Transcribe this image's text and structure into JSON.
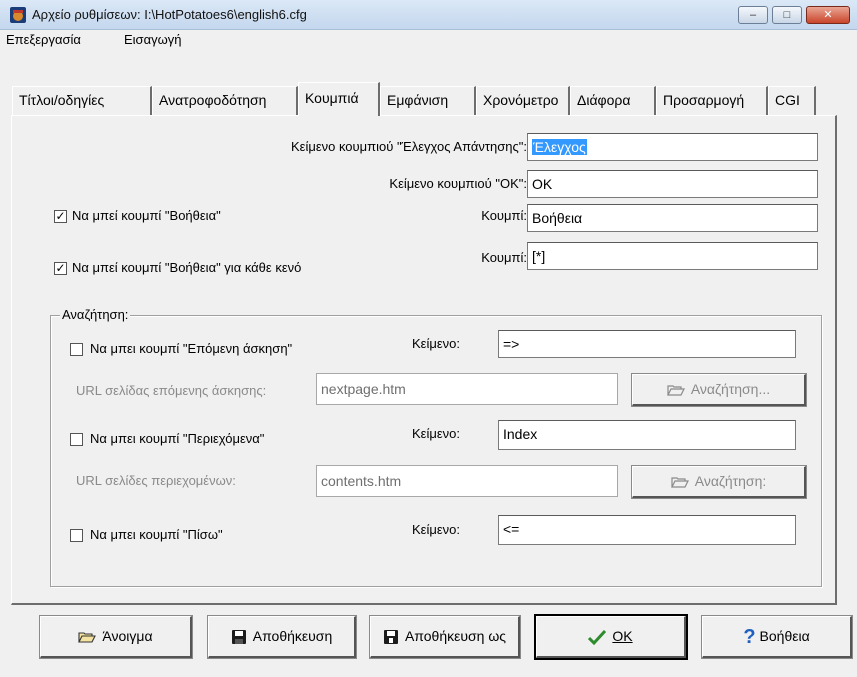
{
  "window": {
    "title": "Αρχείο ρυθμίσεων: I:\\HotPotatoes6\\english6.cfg",
    "minimize": "‒",
    "maximize": "□",
    "close": "✕"
  },
  "menu": [
    "Επεξεργασία",
    "Εισαγωγή"
  ],
  "tabs": [
    "Τίτλοι/οδηγίες",
    "Ανατροφοδότηση",
    "Κουμπιά",
    "Εμφάνιση",
    "Χρονόμετρο",
    "Διάφορα",
    "Προσαρμογή",
    "CGI"
  ],
  "active_tab": "Κουμπιά",
  "buttons_tab": {
    "check_label": "Κείμενο κουμπιού \"Έλεγχος Απάντησης\":",
    "check_value": "Έλεγχος",
    "ok_label": "Κείμενο κουμπιού \"ΟΚ\":",
    "ok_value": "OK",
    "hint": {
      "label": "Να μπεί κουμπί \"Βοήθεια\"",
      "checked": true,
      "mark": "✓",
      "button_label": "Κουμπί:",
      "value": "Βοήθεια"
    },
    "hint_each_gap": {
      "label": "Να μπεί κουμπί \"Βοήθεια\" για κάθε κενό",
      "checked": true,
      "mark": "✓",
      "button_label": "Κουμπί:",
      "value": "[*]"
    }
  },
  "navigation": {
    "legend": "Αναζήτηση:",
    "next": {
      "label": "Να μπει κουμπί \"Επόμενη άσκηση\"",
      "checked": false,
      "text_label": "Κείμενο:",
      "text_value": "=>",
      "url_label": "URL σελίδας επόμενης άσκησης:",
      "url_value": "nextpage.htm",
      "browse": "Αναζήτηση..."
    },
    "contents": {
      "label": "Να μπει κουμπί \"Περιεχόμενα\"",
      "checked": false,
      "text_label": "Κείμενο:",
      "text_value": "Index",
      "url_label": "URL σελίδες περιεχομένων:",
      "url_value": "contents.htm",
      "browse": "Αναζήτηση:"
    },
    "back": {
      "label": "Να μπει κουμπί \"Πίσω\"",
      "checked": false,
      "text_label": "Κείμενο:",
      "text_value": "<="
    }
  },
  "footer": {
    "open": "Άνοιγμα",
    "save": "Αποθήκευση",
    "save_as": "Αποθήκευση ως",
    "ok": "OK",
    "help": "Βοήθεια"
  },
  "colors": {
    "selection": "#3399ff",
    "ok_check": "#2e8b2e",
    "help_question": "#1f5fbf"
  }
}
